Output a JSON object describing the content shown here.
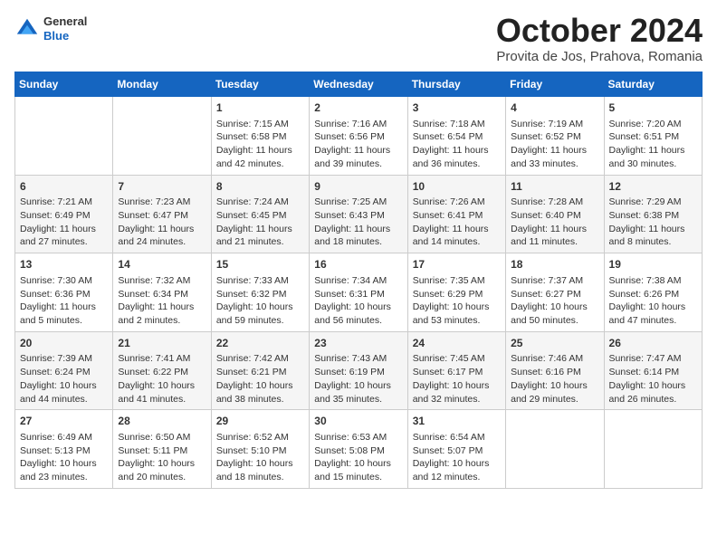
{
  "header": {
    "logo": {
      "general": "General",
      "blue": "Blue"
    },
    "title": "October 2024",
    "location": "Provita de Jos, Prahova, Romania"
  },
  "days_of_week": [
    "Sunday",
    "Monday",
    "Tuesday",
    "Wednesday",
    "Thursday",
    "Friday",
    "Saturday"
  ],
  "weeks": [
    [
      {
        "day": "",
        "info": ""
      },
      {
        "day": "",
        "info": ""
      },
      {
        "day": "1",
        "info": "Sunrise: 7:15 AM\nSunset: 6:58 PM\nDaylight: 11 hours and 42 minutes."
      },
      {
        "day": "2",
        "info": "Sunrise: 7:16 AM\nSunset: 6:56 PM\nDaylight: 11 hours and 39 minutes."
      },
      {
        "day": "3",
        "info": "Sunrise: 7:18 AM\nSunset: 6:54 PM\nDaylight: 11 hours and 36 minutes."
      },
      {
        "day": "4",
        "info": "Sunrise: 7:19 AM\nSunset: 6:52 PM\nDaylight: 11 hours and 33 minutes."
      },
      {
        "day": "5",
        "info": "Sunrise: 7:20 AM\nSunset: 6:51 PM\nDaylight: 11 hours and 30 minutes."
      }
    ],
    [
      {
        "day": "6",
        "info": "Sunrise: 7:21 AM\nSunset: 6:49 PM\nDaylight: 11 hours and 27 minutes."
      },
      {
        "day": "7",
        "info": "Sunrise: 7:23 AM\nSunset: 6:47 PM\nDaylight: 11 hours and 24 minutes."
      },
      {
        "day": "8",
        "info": "Sunrise: 7:24 AM\nSunset: 6:45 PM\nDaylight: 11 hours and 21 minutes."
      },
      {
        "day": "9",
        "info": "Sunrise: 7:25 AM\nSunset: 6:43 PM\nDaylight: 11 hours and 18 minutes."
      },
      {
        "day": "10",
        "info": "Sunrise: 7:26 AM\nSunset: 6:41 PM\nDaylight: 11 hours and 14 minutes."
      },
      {
        "day": "11",
        "info": "Sunrise: 7:28 AM\nSunset: 6:40 PM\nDaylight: 11 hours and 11 minutes."
      },
      {
        "day": "12",
        "info": "Sunrise: 7:29 AM\nSunset: 6:38 PM\nDaylight: 11 hours and 8 minutes."
      }
    ],
    [
      {
        "day": "13",
        "info": "Sunrise: 7:30 AM\nSunset: 6:36 PM\nDaylight: 11 hours and 5 minutes."
      },
      {
        "day": "14",
        "info": "Sunrise: 7:32 AM\nSunset: 6:34 PM\nDaylight: 11 hours and 2 minutes."
      },
      {
        "day": "15",
        "info": "Sunrise: 7:33 AM\nSunset: 6:32 PM\nDaylight: 10 hours and 59 minutes."
      },
      {
        "day": "16",
        "info": "Sunrise: 7:34 AM\nSunset: 6:31 PM\nDaylight: 10 hours and 56 minutes."
      },
      {
        "day": "17",
        "info": "Sunrise: 7:35 AM\nSunset: 6:29 PM\nDaylight: 10 hours and 53 minutes."
      },
      {
        "day": "18",
        "info": "Sunrise: 7:37 AM\nSunset: 6:27 PM\nDaylight: 10 hours and 50 minutes."
      },
      {
        "day": "19",
        "info": "Sunrise: 7:38 AM\nSunset: 6:26 PM\nDaylight: 10 hours and 47 minutes."
      }
    ],
    [
      {
        "day": "20",
        "info": "Sunrise: 7:39 AM\nSunset: 6:24 PM\nDaylight: 10 hours and 44 minutes."
      },
      {
        "day": "21",
        "info": "Sunrise: 7:41 AM\nSunset: 6:22 PM\nDaylight: 10 hours and 41 minutes."
      },
      {
        "day": "22",
        "info": "Sunrise: 7:42 AM\nSunset: 6:21 PM\nDaylight: 10 hours and 38 minutes."
      },
      {
        "day": "23",
        "info": "Sunrise: 7:43 AM\nSunset: 6:19 PM\nDaylight: 10 hours and 35 minutes."
      },
      {
        "day": "24",
        "info": "Sunrise: 7:45 AM\nSunset: 6:17 PM\nDaylight: 10 hours and 32 minutes."
      },
      {
        "day": "25",
        "info": "Sunrise: 7:46 AM\nSunset: 6:16 PM\nDaylight: 10 hours and 29 minutes."
      },
      {
        "day": "26",
        "info": "Sunrise: 7:47 AM\nSunset: 6:14 PM\nDaylight: 10 hours and 26 minutes."
      }
    ],
    [
      {
        "day": "27",
        "info": "Sunrise: 6:49 AM\nSunset: 5:13 PM\nDaylight: 10 hours and 23 minutes."
      },
      {
        "day": "28",
        "info": "Sunrise: 6:50 AM\nSunset: 5:11 PM\nDaylight: 10 hours and 20 minutes."
      },
      {
        "day": "29",
        "info": "Sunrise: 6:52 AM\nSunset: 5:10 PM\nDaylight: 10 hours and 18 minutes."
      },
      {
        "day": "30",
        "info": "Sunrise: 6:53 AM\nSunset: 5:08 PM\nDaylight: 10 hours and 15 minutes."
      },
      {
        "day": "31",
        "info": "Sunrise: 6:54 AM\nSunset: 5:07 PM\nDaylight: 10 hours and 12 minutes."
      },
      {
        "day": "",
        "info": ""
      },
      {
        "day": "",
        "info": ""
      }
    ]
  ]
}
